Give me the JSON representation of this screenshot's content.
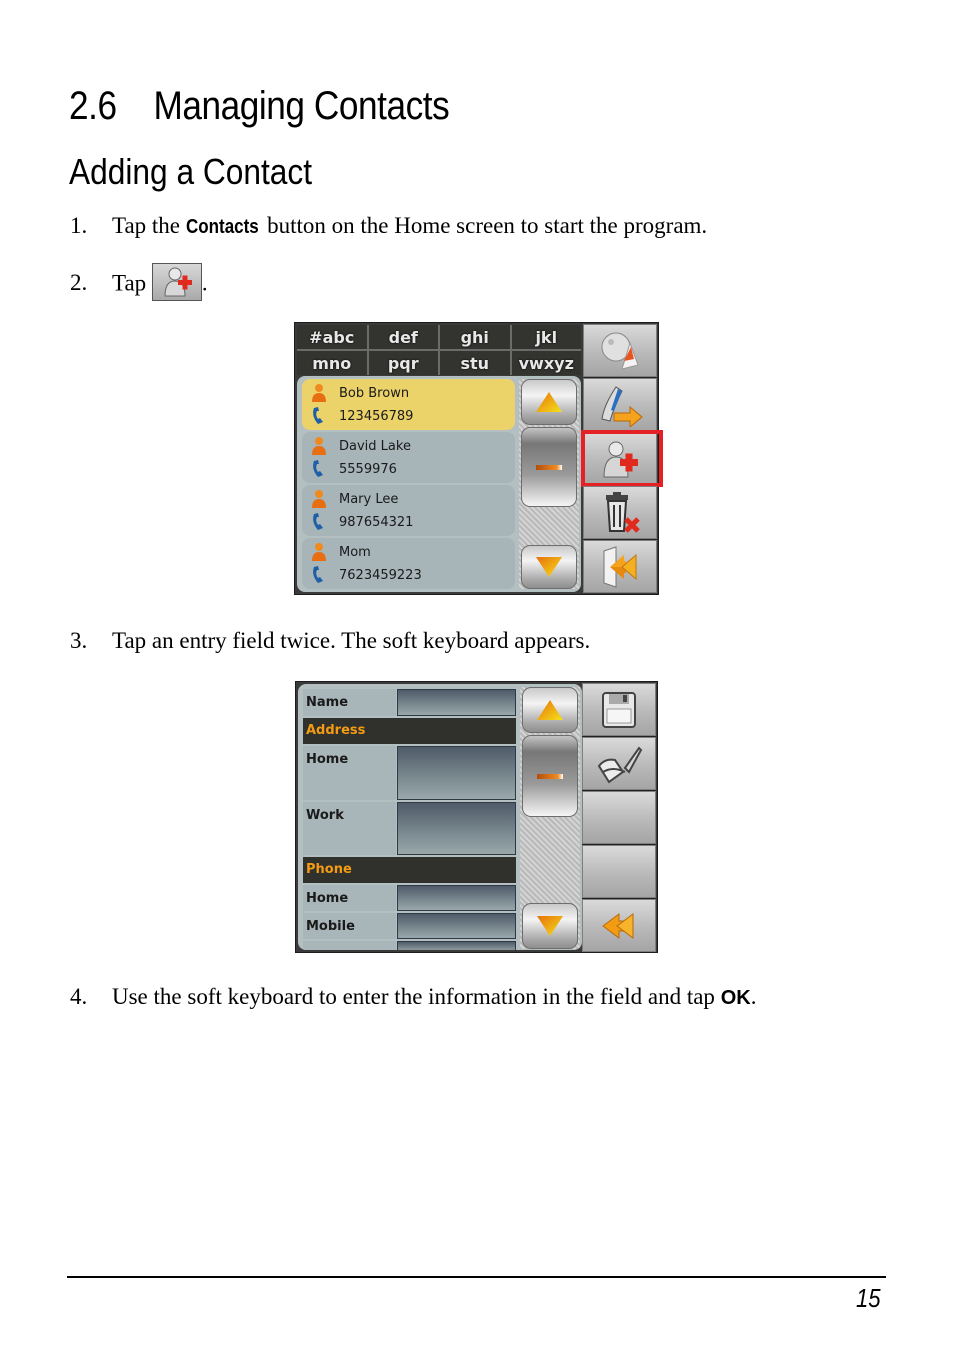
{
  "section": {
    "number": "2.6",
    "title": "Managing Contacts"
  },
  "subsection": {
    "title": "Adding a Contact"
  },
  "steps": [
    {
      "num": "1.",
      "pre": "Tap the ",
      "ui": "Contacts",
      "post": " button on the Home screen to start the program."
    },
    {
      "num": "2.",
      "pre": "Tap ",
      "icon": "add-contact-icon",
      "post": "."
    },
    {
      "num": "3.",
      "text": "Tap an entry field twice. The soft keyboard appears."
    },
    {
      "num": "4.",
      "pre": "Use the soft keyboard to enter the information in the field and tap ",
      "ui": "OK",
      "post": "."
    }
  ],
  "contacts_screen": {
    "keypad": [
      "#abc",
      "def",
      "ghi",
      "jkl",
      "mno",
      "pqr",
      "stu",
      "vwxyz"
    ],
    "contacts": [
      {
        "name": "Bob Brown",
        "phone": "123456789",
        "selected": true
      },
      {
        "name": "David Lake",
        "phone": "5559976",
        "selected": false
      },
      {
        "name": "Mary Lee",
        "phone": "987654321",
        "selected": false
      },
      {
        "name": "Mom",
        "phone": "7623459223",
        "selected": false
      }
    ],
    "side_buttons": [
      "navigate-to-contact-icon",
      "call-contact-icon",
      "add-contact-icon",
      "delete-contact-icon",
      "exit-icon"
    ],
    "highlighted_button": "add-contact-icon",
    "highlight_color": "#e42226",
    "selected_color": "#ebd36a"
  },
  "edit_screen": {
    "rows": [
      {
        "type": "field",
        "label": "Name"
      },
      {
        "type": "section",
        "label": "Address"
      },
      {
        "type": "field",
        "label": "Home"
      },
      {
        "type": "field",
        "label": "Work"
      },
      {
        "type": "section",
        "label": "Phone"
      },
      {
        "type": "field",
        "label": "Home"
      },
      {
        "type": "field",
        "label": "Mobile"
      }
    ],
    "side_buttons": [
      "save-icon",
      "edit-icon",
      "",
      "",
      "back-icon"
    ],
    "section_color": "#f39b12"
  },
  "footer": {
    "page_number": "15"
  }
}
